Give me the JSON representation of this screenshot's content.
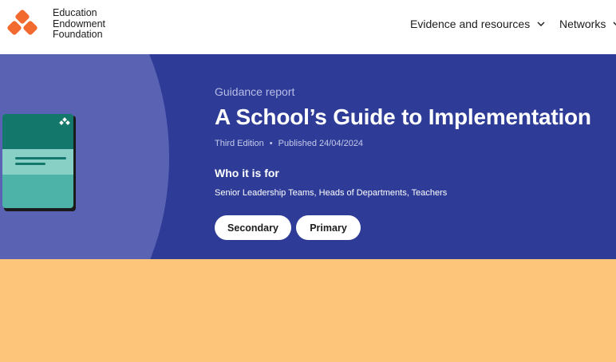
{
  "header": {
    "logo_lines": [
      "Education",
      "Endowment",
      "Foundation"
    ],
    "nav": [
      {
        "label": "Evidence and resources"
      },
      {
        "label": "Networks"
      }
    ]
  },
  "hero": {
    "eyebrow": "Guidance report",
    "title": "A School’s Guide to Implementation",
    "edition": "Third Edition",
    "separator": "•",
    "published": "Published 24/04/2024",
    "audience_heading": "Who it is for",
    "audience_text": "Senior Leadership Teams, Heads of Departments, Teachers",
    "tags": [
      {
        "label": "Secondary"
      },
      {
        "label": "Primary"
      }
    ]
  },
  "colors": {
    "brand_orange": "#f26a2e",
    "hero_blue": "#2e3c98",
    "hero_circle": "#5a62b3",
    "footer_band": "#fcc57a"
  }
}
